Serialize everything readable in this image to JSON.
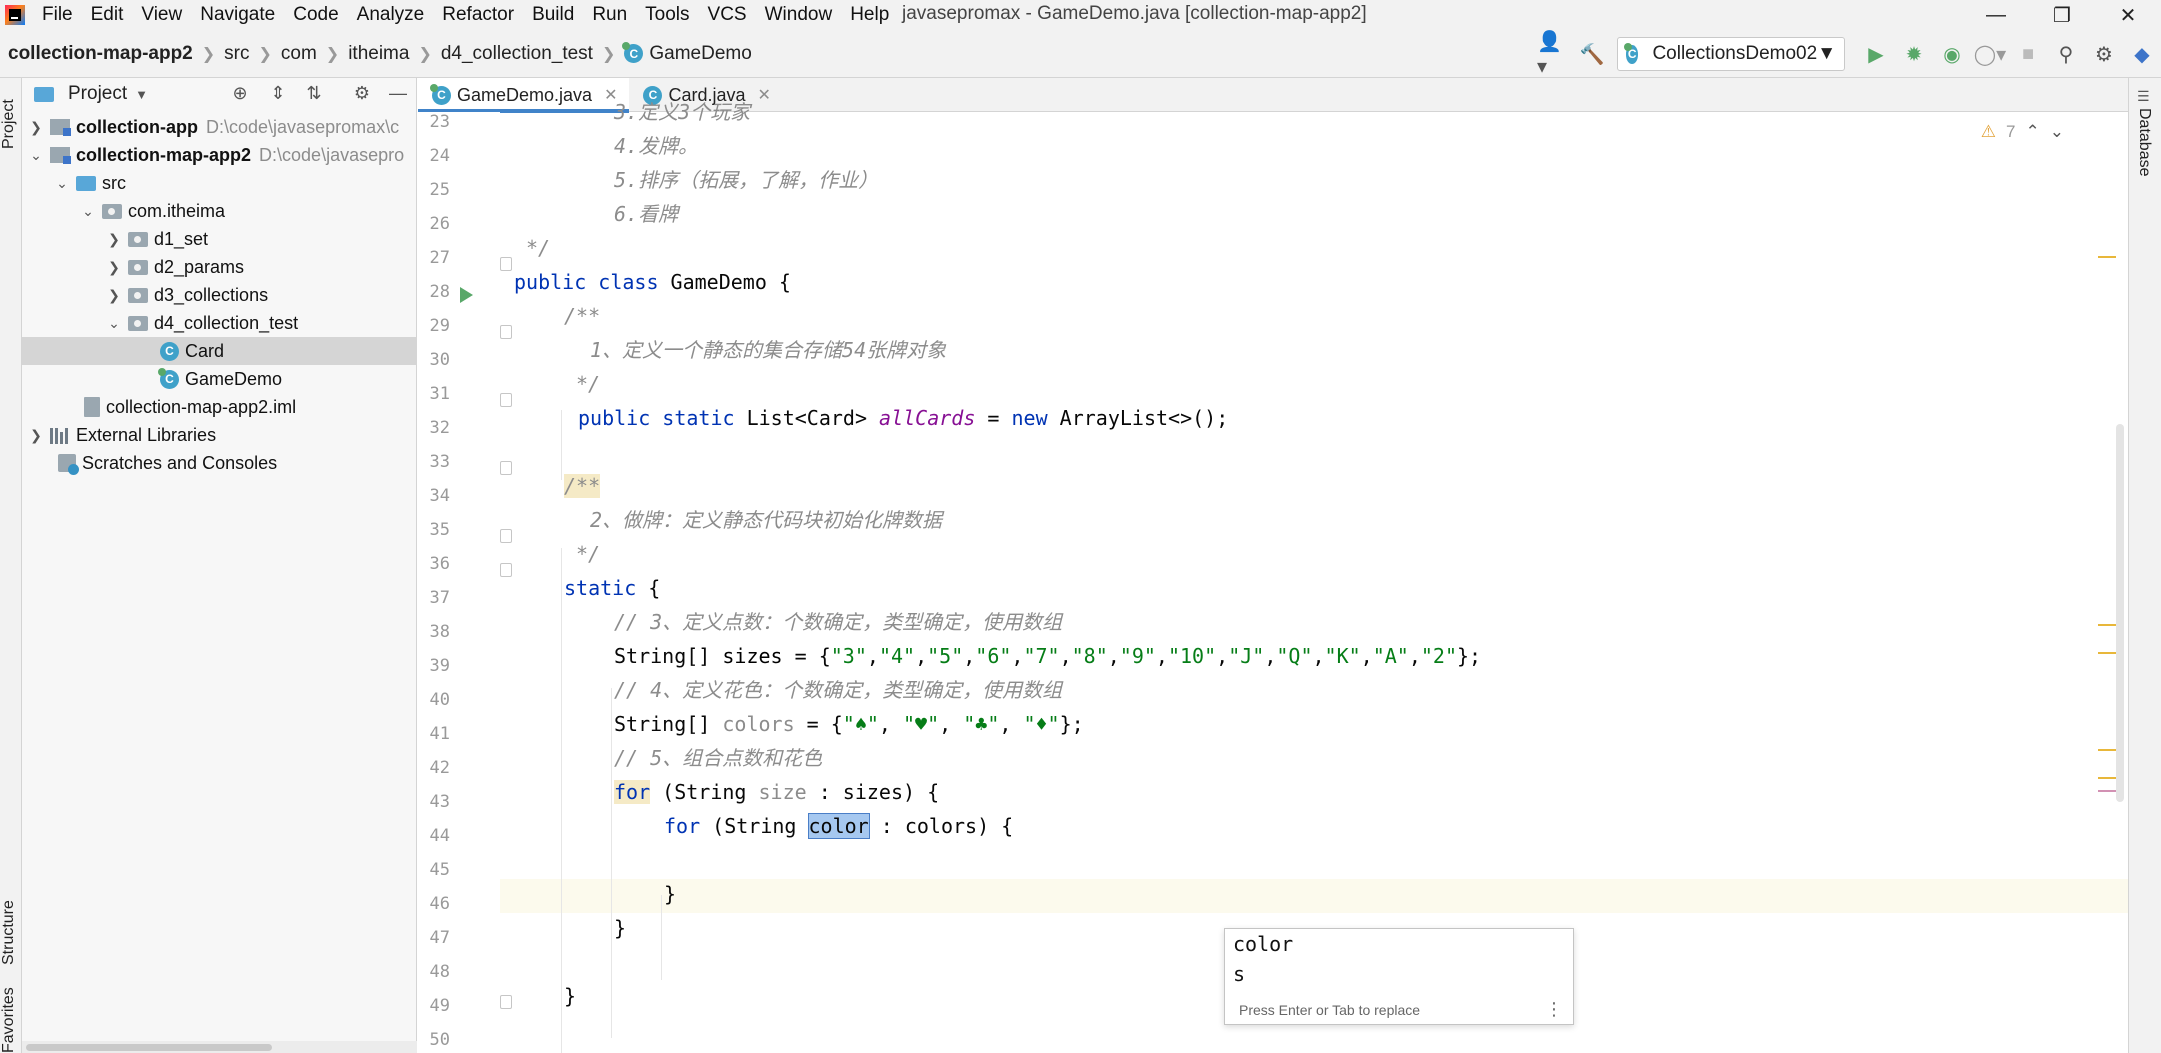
{
  "menubar": {
    "items": [
      "File",
      "Edit",
      "View",
      "Navigate",
      "Code",
      "Analyze",
      "Refactor",
      "Build",
      "Run",
      "Tools",
      "VCS",
      "Window",
      "Help"
    ],
    "window_title": "javasepromax - GameDemo.java [collection-map-app2]"
  },
  "navbar": {
    "breadcrumbs": [
      "collection-map-app2",
      "src",
      "com",
      "itheima",
      "d4_collection_test",
      "GameDemo"
    ],
    "run_config": "CollectionsDemo02"
  },
  "left_strip": {
    "project": "Project",
    "structure": "Structure",
    "favorites": "Favorites"
  },
  "right_strip": {
    "database": "Database"
  },
  "project_panel": {
    "title": "Project",
    "tree": [
      {
        "label": "collection-app",
        "path": "D:\\code\\javasepromax\\c",
        "bold": true
      },
      {
        "label": "collection-map-app2",
        "path": "D:\\code\\javasepro",
        "bold": true
      },
      {
        "label": "src"
      },
      {
        "label": "com.itheima"
      },
      {
        "label": "d1_set"
      },
      {
        "label": "d2_params"
      },
      {
        "label": "d3_collections"
      },
      {
        "label": "d4_collection_test"
      },
      {
        "label": "Card"
      },
      {
        "label": "GameDemo"
      },
      {
        "label": "collection-map-app2.iml"
      },
      {
        "label": "External Libraries"
      },
      {
        "label": "Scratches and Consoles"
      }
    ]
  },
  "editor": {
    "tabs": [
      "GameDemo.java",
      "Card.java"
    ],
    "inspection_count": "7",
    "line_numbers": [
      "23",
      "24",
      "25",
      "26",
      "27",
      "28",
      "29",
      "30",
      "31",
      "32",
      "33",
      "34",
      "35",
      "36",
      "37",
      "38",
      "39",
      "40",
      "41",
      "42",
      "43",
      "44",
      "45",
      "46",
      "47",
      "48",
      "49",
      "50"
    ],
    "code": {
      "l23": "3.定义3个玩家",
      "l24": "4.发牌。",
      "l25": "5.排序（拓展，了解，作业）",
      "l26": "6.看牌",
      "l27": "*/",
      "l29": "/**",
      "l30": "1、定义一个静态的集合存储54张牌对象",
      "l31": "*/",
      "l34": "/**",
      "l35": "2、做牌：定义静态代码块初始化牌数据",
      "l36": "*/",
      "l38": "// 3、定义点数：个数确定，类型确定，使用数组",
      "l40": "// 4、定义花色：个数确定，类型确定，使用数组",
      "l42": "// 5、组合点数和花色"
    }
  },
  "completion": {
    "items": [
      "color",
      "s"
    ],
    "hint": "Press Enter or Tab to replace"
  },
  "colors": {
    "keyword": "#0033b3",
    "string": "#067d17",
    "comment": "#8c8c8c",
    "field": "#871094",
    "accent": "#4083c9",
    "run_green": "#59a869"
  }
}
